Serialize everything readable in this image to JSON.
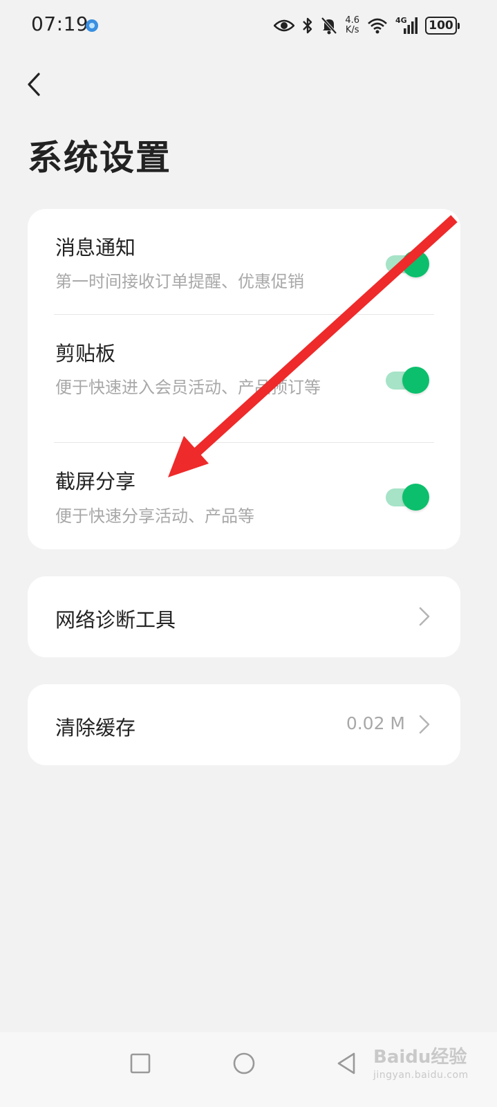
{
  "status_bar": {
    "time": "07:19",
    "net_speed_value": "4.6",
    "net_speed_unit": "K/s",
    "network_type": "4G",
    "battery": "100",
    "icons": [
      "app-notification-icon",
      "eye-comfort-icon",
      "bluetooth-icon",
      "mute-icon",
      "wifi-icon",
      "signal-icon",
      "battery-icon"
    ]
  },
  "header": {
    "back_icon": "chevron-left-icon",
    "title": "系统设置"
  },
  "toggles": [
    {
      "title": "消息通知",
      "description": "第一时间接收订单提醒、优惠促销",
      "enabled": true
    },
    {
      "title": "剪贴板",
      "description": "便于快速进入会员活动、产品预订等",
      "enabled": true
    },
    {
      "title": "截屏分享",
      "description": "便于快速分享活动、产品等",
      "enabled": true
    }
  ],
  "network_tool": {
    "label": "网络诊断工具"
  },
  "clear_cache": {
    "label": "清除缓存",
    "value": "0.02 M"
  },
  "nav_bar": {
    "buttons": [
      "recents-square-icon",
      "home-circle-icon",
      "back-triangle-icon"
    ]
  },
  "watermark": {
    "main": "Baidu经验",
    "sub": "jingyan.baidu.com"
  },
  "colors": {
    "background": "#f2f2f2",
    "card": "#ffffff",
    "switch_on_knob": "#0cbf6c",
    "switch_on_track": "#a6e3c7",
    "annotation_arrow": "#ee2a2a",
    "secondary_text": "#a8a8a8"
  }
}
